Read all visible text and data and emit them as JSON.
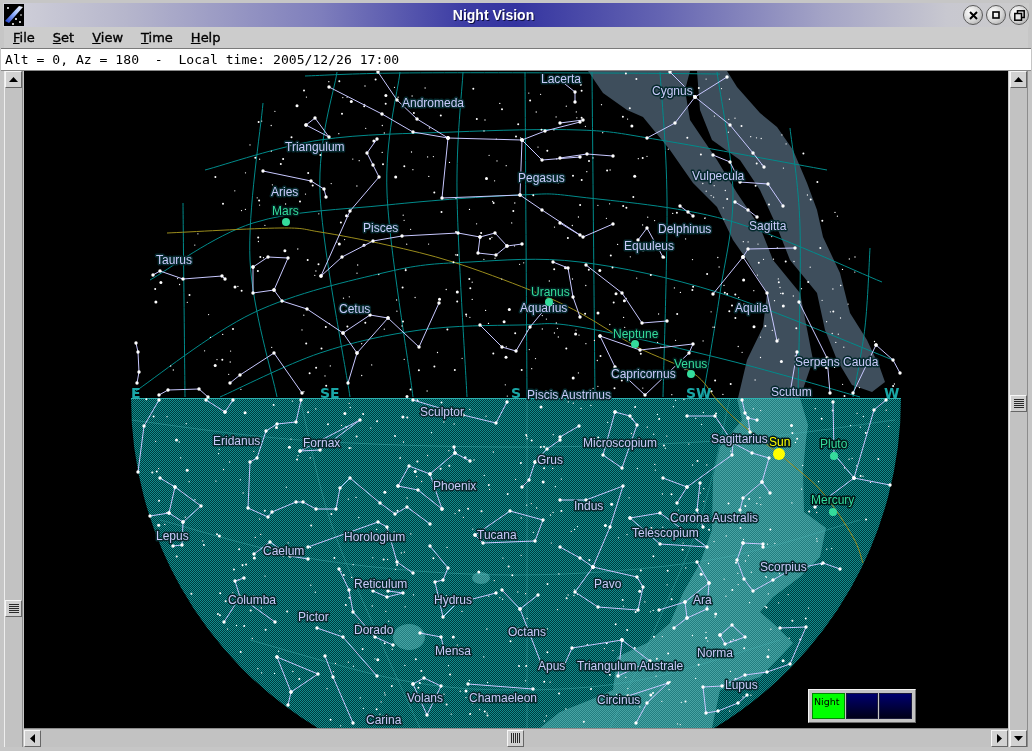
{
  "window": {
    "title": "Night Vision"
  },
  "menu": [
    "File",
    "Set",
    "View",
    "Time",
    "Help"
  ],
  "status": "Alt = 0, Az = 180  -  Local time: 2005/12/26 17:00",
  "sky_map": {
    "compass": [
      "E",
      "SE",
      "S",
      "SW",
      "W"
    ],
    "constellations": [
      "Lacerta",
      "Cygnus",
      "Andromeda",
      "Triangulum",
      "Pegasus",
      "Vulpecula",
      "Aries",
      "Pisces",
      "Delphinus",
      "Sagitta",
      "Equuleus",
      "Taurus",
      "Cetus",
      "Aquarius",
      "Aquila",
      "Serpens Cauda",
      "Capricornus",
      "Piscis Austrinus",
      "Scutum",
      "Sculptor",
      "Eridanus",
      "Fornax",
      "Microscopium",
      "Sagittarius",
      "Grus",
      "Phoenix",
      "Indus",
      "Corona Australis",
      "Lepus",
      "Horologium",
      "Tucana",
      "Telescopium",
      "Caelum",
      "Scorpius",
      "Reticulum",
      "Pavo",
      "Columba",
      "Hydrus",
      "Ara",
      "Pictor",
      "Dorado",
      "Octans",
      "Mensa",
      "Norma",
      "Apus",
      "Triangulum Australe",
      "Lupus",
      "Volans",
      "Chamaeleon",
      "Circinus",
      "Carina"
    ],
    "planets": [
      {
        "name": "Mars",
        "kind": "planet",
        "color": "#34dc9c"
      },
      {
        "name": "Uranus",
        "kind": "planet",
        "color": "#34dc9c"
      },
      {
        "name": "Neptune",
        "kind": "planet",
        "color": "#34dc9c"
      },
      {
        "name": "Venus",
        "kind": "planet",
        "color": "#34dc9c"
      },
      {
        "name": "Sun",
        "kind": "star",
        "color": "#ffff00"
      },
      {
        "name": "Pluto",
        "kind": "planet",
        "color": "#34dc9c"
      },
      {
        "name": "Mercury",
        "kind": "planet",
        "color": "#34dc9c"
      }
    ]
  },
  "mode_indicator": [
    {
      "label": "Night",
      "selected": true
    },
    {
      "selected": false
    },
    {
      "selected": false
    }
  ]
}
